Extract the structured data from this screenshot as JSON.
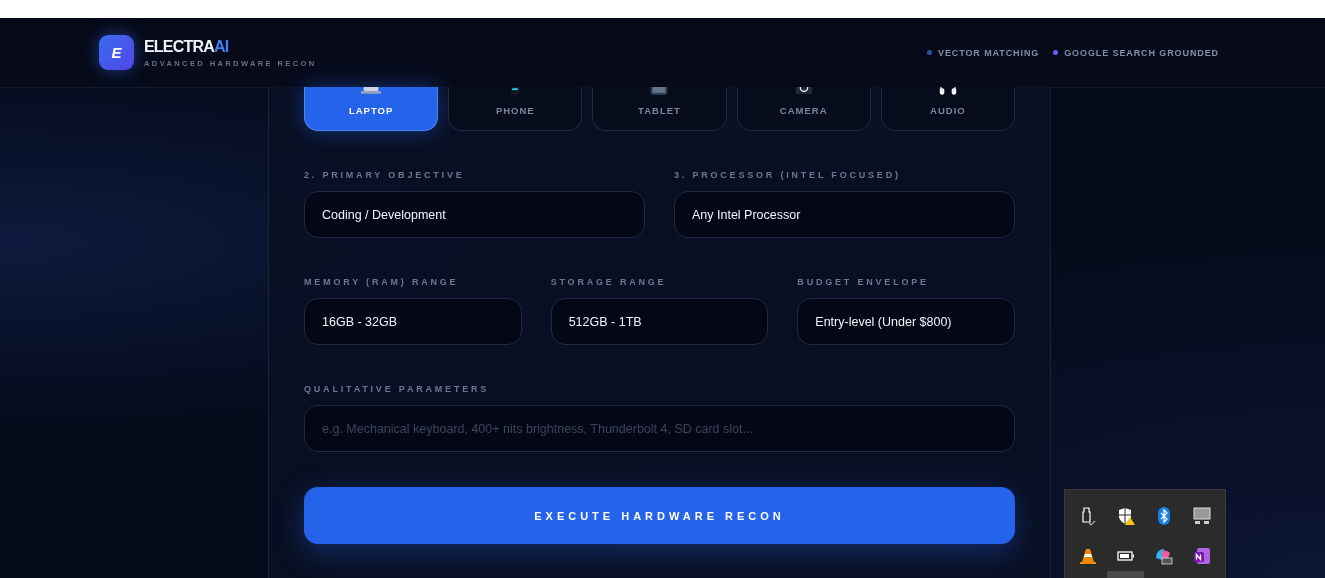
{
  "header": {
    "logo_letter": "E",
    "brand": "ELECTRA",
    "brand_accent": "AI",
    "tagline": "ADVANCED HARDWARE RECON",
    "badges": [
      {
        "label": "VECTOR MATCHING",
        "color": "#2f4fa8"
      },
      {
        "label": "GOOGLE SEARCH GROUNDED",
        "color": "#6366f1"
      }
    ]
  },
  "device_types": [
    {
      "label": "LAPTOP",
      "kind": "laptop",
      "selected": true
    },
    {
      "label": "PHONE",
      "kind": "phone",
      "selected": false
    },
    {
      "label": "TABLET",
      "kind": "tablet",
      "selected": false
    },
    {
      "label": "CAMERA",
      "kind": "camera",
      "selected": false
    },
    {
      "label": "AUDIO",
      "kind": "audio",
      "selected": false
    }
  ],
  "field_rows": [
    {
      "fields": [
        {
          "label": "2. PRIMARY OBJECTIVE",
          "value": "Coding / Development"
        },
        {
          "label": "3. PROCESSOR (INTEL FOCUSED)",
          "value": "Any Intel Processor"
        }
      ]
    },
    {
      "fields": [
        {
          "label": "MEMORY (RAM) RANGE",
          "value": "16GB - 32GB"
        },
        {
          "label": "STORAGE RANGE",
          "value": "512GB - 1TB"
        },
        {
          "label": "BUDGET ENVELOPE",
          "value": "Entry-level (Under $800)"
        }
      ]
    }
  ],
  "qualitative": {
    "label": "QUALITATIVE PARAMETERS",
    "placeholder": "e.g. Mechanical keyboard, 400+ nits brightness, Thunderbolt 4, SD card slot..."
  },
  "execute_button": "EXECUTE HARDWARE RECON"
}
